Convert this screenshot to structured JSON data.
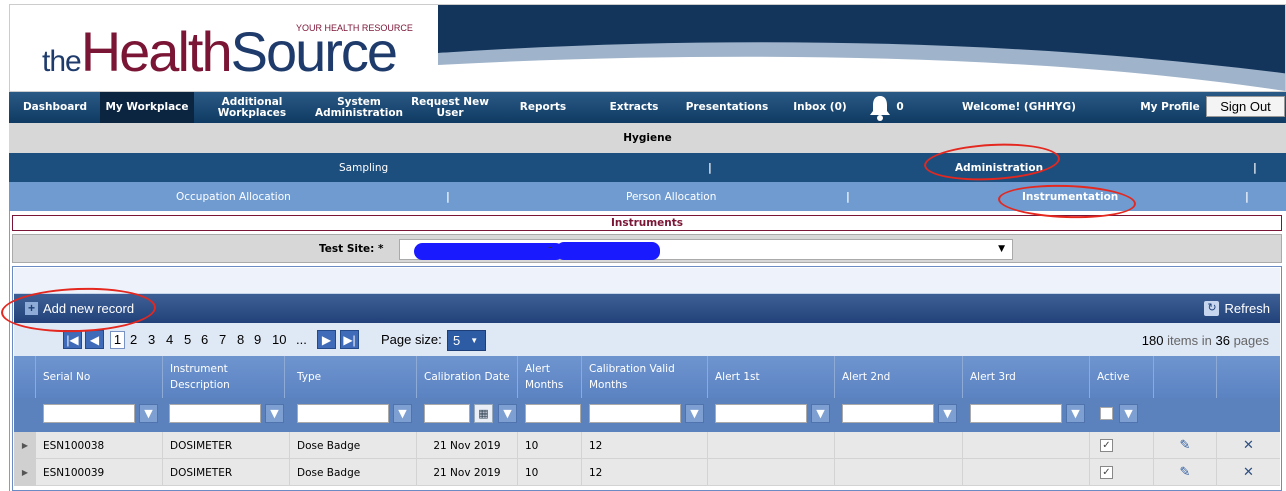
{
  "logo": {
    "the": "the",
    "health": "Health",
    "source": "Source",
    "tagline": "YOUR HEALTH RESOURCE"
  },
  "nav": {
    "items": [
      "Dashboard",
      "My Workplace",
      "Additional Workplaces",
      "System Administration",
      "Request New User",
      "Reports",
      "Extracts",
      "Presentations",
      "Inbox (0)",
      "0",
      "Welcome! (GHHYG)",
      "My Profile"
    ],
    "sign_out": "Sign Out"
  },
  "section_title": "Hygiene",
  "tabs1": {
    "sampling": "Sampling",
    "sep": "|",
    "administration": "Administration"
  },
  "tabs2": {
    "occupation": "Occupation Allocation",
    "person": "Person Allocation",
    "instrumentation": "Instrumentation",
    "sep": "|"
  },
  "panel_title": "Instruments",
  "test_site": {
    "label": "Test Site: *",
    "dash": "-"
  },
  "toolbar": {
    "add": "Add new record",
    "refresh": "Refresh"
  },
  "pager": {
    "pages": [
      "1",
      "2",
      "3",
      "4",
      "5",
      "6",
      "7",
      "8",
      "9",
      "10",
      "..."
    ],
    "page_size_label": "Page size:",
    "page_size": "5",
    "items_count": "180",
    "items_in": "items in",
    "pages_count": "36",
    "pages_word": "pages"
  },
  "columns": [
    "Serial No",
    "Instrument Description",
    "Type",
    "Calibration Date",
    "Alert Months",
    "Calibration Valid Months",
    "Alert 1st",
    "Alert 2nd",
    "Alert 3rd",
    "Active"
  ],
  "rows": [
    {
      "serial": "ESN100038",
      "desc": "DOSIMETER",
      "type": "Dose Badge",
      "cal_date": "21 Nov 2019",
      "alert_months": "10",
      "valid_months": "12",
      "active": true
    },
    {
      "serial": "ESN100039",
      "desc": "DOSIMETER",
      "type": "Dose Badge",
      "cal_date": "21 Nov 2019",
      "alert_months": "10",
      "valid_months": "12",
      "active": true
    }
  ],
  "colors": {
    "nav_dark": "#0f3a62",
    "sub_tab": "#1d4f7e",
    "sub_tab2": "#6f9bd0",
    "brand_red": "#7a1535",
    "annotation": "#e4281f"
  }
}
